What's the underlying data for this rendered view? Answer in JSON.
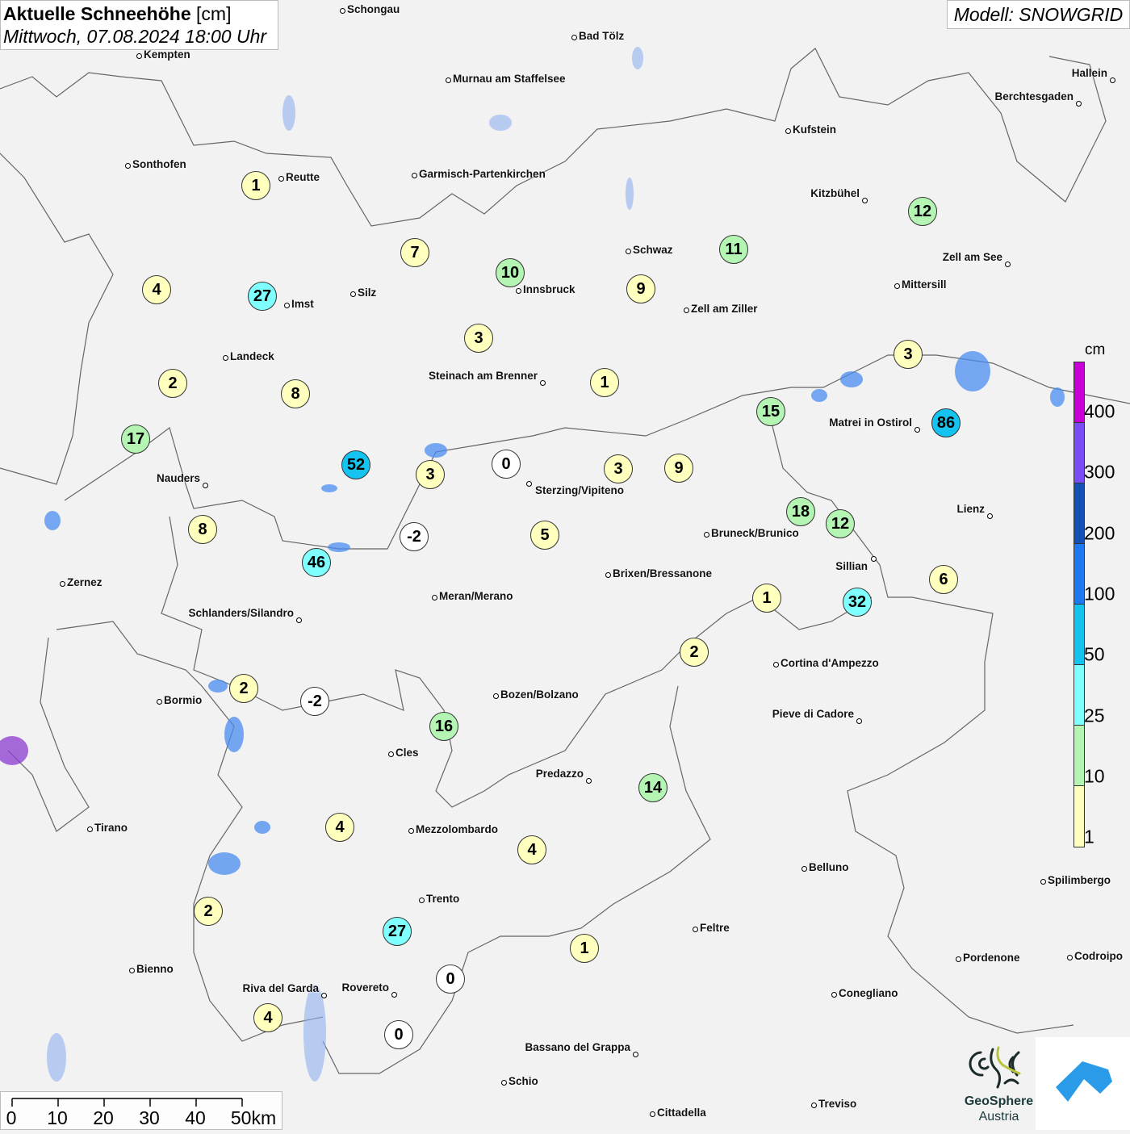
{
  "header": {
    "title_bold": "Aktuelle Schneehöhe",
    "title_unit": "[cm]",
    "datetime": "Mittwoch, 07.08.2024 18:00 Uhr",
    "model": "Modell: SNOWGRID"
  },
  "legend": {
    "unit": "cm",
    "labels": [
      "400",
      "300",
      "200",
      "100",
      "50",
      "25",
      "10",
      "1"
    ],
    "colors": [
      "#c800d8",
      "#7a4cf5",
      "#1450b4",
      "#1e78f0",
      "#14c3f0",
      "#80ffff",
      "#b4f5b4",
      "#ffffbe"
    ]
  },
  "marker_colors": {
    "zero": "#ffffff",
    "1-10": "#ffffbe",
    "10-25": "#b4f5b4",
    "25-50": "#80ffff",
    "50-100": "#14c3f0"
  },
  "markers": [
    "1",
    "7",
    "10",
    "11",
    "12",
    "4",
    "27",
    "9",
    "3",
    "2",
    "8",
    "1",
    "3",
    "15",
    "86",
    "17",
    "52",
    "3",
    "0",
    "3",
    "9",
    "8",
    "-2",
    "5",
    "18",
    "12",
    "46",
    "6",
    "1",
    "32",
    "2",
    "2",
    "-2",
    "16",
    "14",
    "4",
    "4",
    "2",
    "27",
    "1",
    "0",
    "4",
    "0"
  ],
  "cities": [
    "Schongau",
    "Bad Tölz",
    "Kempten",
    "Murnau am Staffelsee",
    "Hallein",
    "Berchtesgaden",
    "Kufstein",
    "Sonthofen",
    "Reutte",
    "Garmisch-Partenkirchen",
    "Kitzbühel",
    "Schwaz",
    "Zell am See",
    "Mittersill",
    "Innsbruck",
    "Silz",
    "Imst",
    "Zell am Ziller",
    "Landeck",
    "Steinach am Brenner",
    "Matrei in Ostirol",
    "Nauders",
    "Sterzing/Vipiteno",
    "Lienz",
    "Bruneck/Brunico",
    "Sillian",
    "Brixen/Bressanone",
    "Zernez",
    "Meran/Merano",
    "Schlanders/Silandro",
    "Cortina d'Ampezzo",
    "Bozen/Bolzano",
    "Bormio",
    "Pieve di Cadore",
    "Cles",
    "Predazzo",
    "Tirano",
    "Mezzolombardo",
    "Belluno",
    "Spilimbergo",
    "Trento",
    "Feltre",
    "Pordenone",
    "Codroipo",
    "Bienno",
    "Riva del Garda",
    "Rovereto",
    "Conegliano",
    "Bassano del Grappa",
    "Schio",
    "Treviso",
    "Cittadella"
  ],
  "scale": {
    "labels": [
      "0",
      "10",
      "20",
      "30",
      "40",
      "50km"
    ]
  },
  "logos": {
    "geosphere_line1": "GeoSphere",
    "geosphere_line2": "Austria"
  }
}
